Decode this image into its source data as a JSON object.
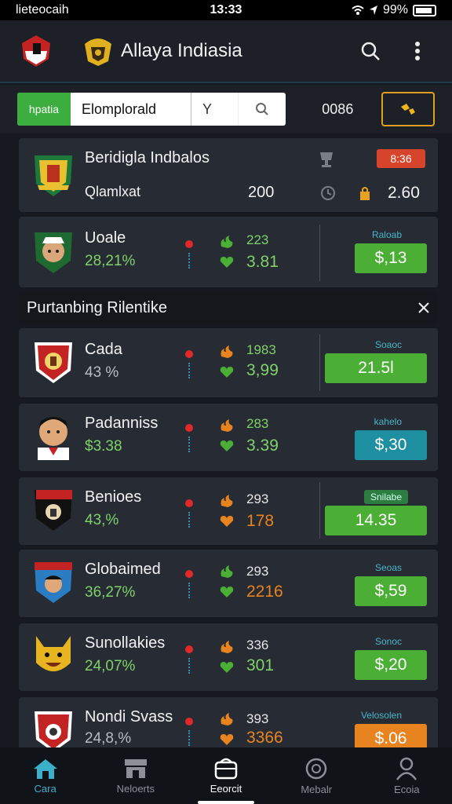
{
  "status": {
    "carrier": "lieteocaih",
    "time": "13:33",
    "battery": "99%"
  },
  "header": {
    "title": "Allaya Indiasia",
    "icons": [
      "flag-shield-icon",
      "garuda-logo-icon",
      "search-icon",
      "more-vertical-icon"
    ]
  },
  "filter": {
    "tag": "hpatia",
    "input_value": "Elomplorald",
    "select_value": "Y",
    "count": "0086"
  },
  "featured": {
    "name": "Beridigla Indbalos",
    "subtitle": "Qlamlxat",
    "value": "200",
    "badge": "8:36",
    "price": "2.60"
  },
  "top_match": {
    "name": "Uoale",
    "pct": "28,21%",
    "odd_top": "223",
    "odd_bottom": "3.81",
    "side_label": "Raloab",
    "price": "$,13"
  },
  "section": {
    "title": "Purtanbing Rilentike"
  },
  "matches": [
    {
      "name": "Cada",
      "pct": "43 %",
      "odd_top": "1983",
      "odd_bottom": "3,99",
      "side_label": "Soaoc",
      "price": "21.5l",
      "color": "#4caf35"
    },
    {
      "name": "Padanniss",
      "pct": "$3.38",
      "odd_top": "283",
      "odd_bottom": "3.39",
      "side_label": "kahelo",
      "price": "$,30",
      "color": "#1e8fa0"
    },
    {
      "name": "Benioes",
      "pct": "43,%",
      "odd_top": "293",
      "odd_bottom": "178",
      "side_label": "Snilabe",
      "price": "14.35",
      "color": "#4caf35"
    },
    {
      "name": "Globaimed",
      "pct": "36,27%",
      "odd_top": "293",
      "odd_bottom": "2216",
      "side_label": "Seoas",
      "price": "$,59",
      "color": "#4caf35"
    },
    {
      "name": "Sunollakies",
      "pct": "24,07%",
      "odd_top": "336",
      "odd_bottom": "301",
      "side_label": "Sonoc",
      "price": "$,20",
      "color": "#4caf35"
    },
    {
      "name": "Nondi Svass",
      "pct": "24,8,%",
      "odd_top": "393",
      "odd_bottom": "3366",
      "side_label": "Velosolen",
      "price": "$.06",
      "color": "#e88420"
    }
  ],
  "nav": [
    {
      "label": "Cara",
      "icon": "home-icon"
    },
    {
      "label": "Neloerts",
      "icon": "store-icon"
    },
    {
      "label": "Eeorcit",
      "icon": "wallet-icon"
    },
    {
      "label": "Mebalr",
      "icon": "globe-icon"
    },
    {
      "label": "Ecoia",
      "icon": "profile-icon"
    }
  ],
  "colors": {
    "accent": "#3cb0c8",
    "green": "#4caf35",
    "orange": "#e88420",
    "card": "#272b33",
    "bg": "#16191f"
  }
}
